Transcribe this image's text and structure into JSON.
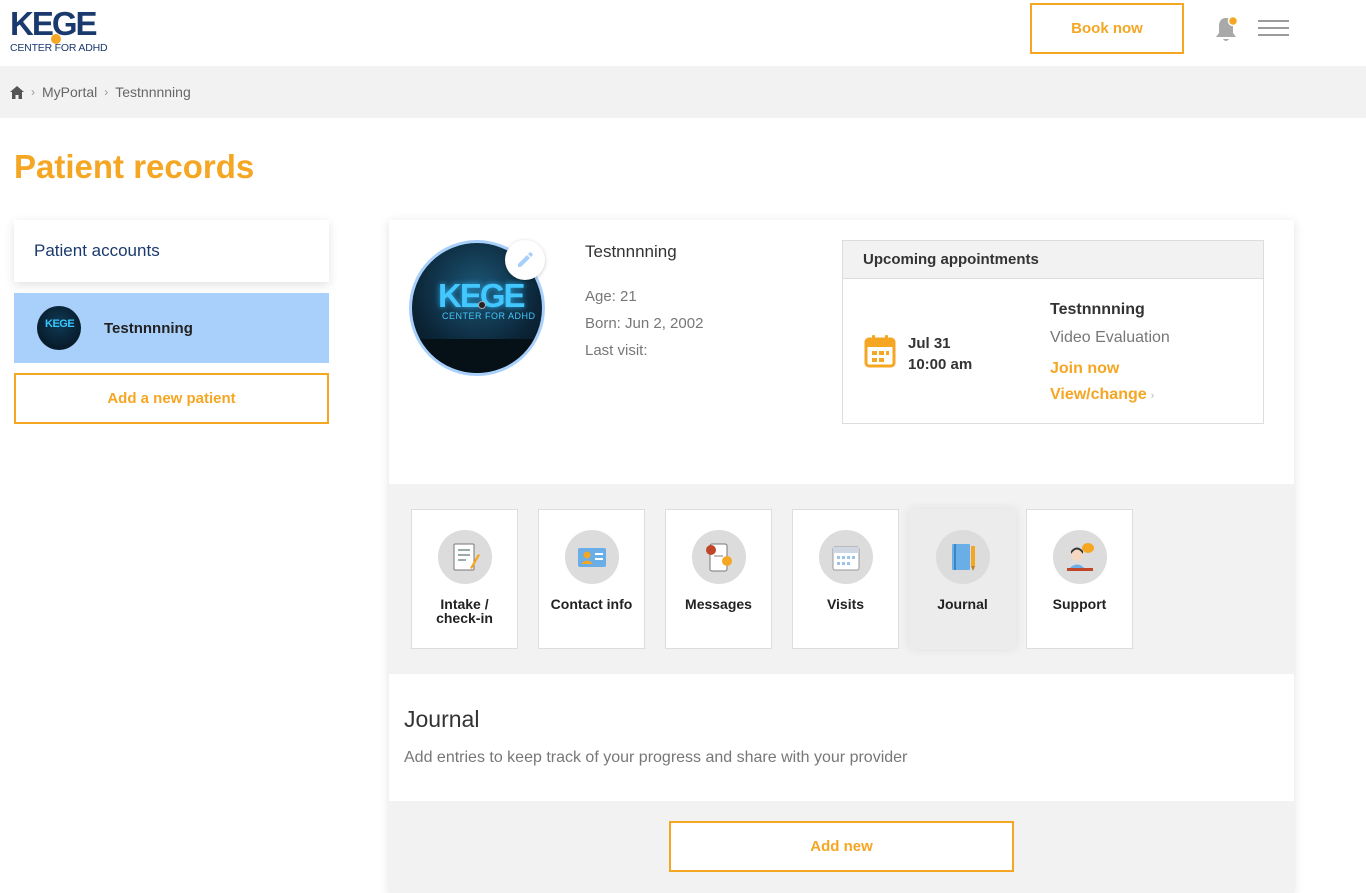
{
  "header": {
    "logo_main": "KEGE",
    "logo_sub": "CENTER FOR ADHD",
    "book_label": "Book now"
  },
  "breadcrumb": {
    "items": [
      "MyPortal",
      "Testnnnning"
    ]
  },
  "page_title": "Patient records",
  "sidebar": {
    "accounts_heading": "Patient accounts",
    "patient_name": "Testnnnning",
    "add_patient_label": "Add a new patient"
  },
  "profile": {
    "name": "Testnnnning",
    "age": "Age: 21",
    "born": "Born: Jun 2, 2002",
    "last_visit": "Last visit:"
  },
  "appointments": {
    "heading": "Upcoming appointments",
    "date": "Jul 31",
    "time": "10:00 am",
    "patient": "Testnnnning",
    "type": "Video Evaluation",
    "join_label": "Join now",
    "view_label": "View/change",
    "view_chevron": "›"
  },
  "tiles": [
    {
      "label": "Intake / check-in",
      "icon": "clipboard-icon"
    },
    {
      "label": "Contact info",
      "icon": "id-card-icon"
    },
    {
      "label": "Messages",
      "icon": "chat-icon"
    },
    {
      "label": "Visits",
      "icon": "calendar-icon"
    },
    {
      "label": "Journal",
      "icon": "notebook-icon"
    },
    {
      "label": "Support",
      "icon": "support-agent-icon"
    }
  ],
  "journal": {
    "title": "Journal",
    "description": "Add entries to keep track of your progress and share with your provider",
    "add_label": "Add new"
  },
  "colors": {
    "accent": "#f5a623",
    "brand": "#1a3a6e",
    "selected_bg": "#a9d0fb",
    "band_bg": "#f2f2f2"
  }
}
